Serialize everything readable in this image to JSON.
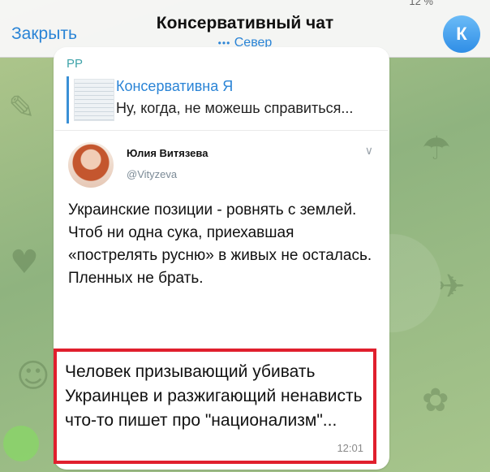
{
  "header": {
    "status_fragment": "12 %",
    "close_label": "Закрыть",
    "title": "Консервативный чат",
    "subtitle_dots": "•••",
    "subtitle": "Север",
    "avatar_letter": "К"
  },
  "message": {
    "sender": "РР",
    "reply": {
      "name": "Консервативна Я",
      "text": "Ну, когда, не можешь справиться..."
    },
    "tweet": {
      "author": "Юлия Витязева",
      "handle": "@Vityzeva",
      "lines": [
        "Украинские позиции - ровнять с землей.",
        "Чтоб ни одна сука, приехавшая «пострелять русню» в живых не осталась.",
        "Пленных не брать."
      ]
    },
    "highlight_text": "Человек призывающий убивать Украинцев и разжигающий ненависть что-то пишет про \"национализм\"...",
    "time": "12:01"
  },
  "colors": {
    "accent": "#2a84d6",
    "highlight_border": "#e01f2d",
    "sender": "#3fa3a9"
  }
}
